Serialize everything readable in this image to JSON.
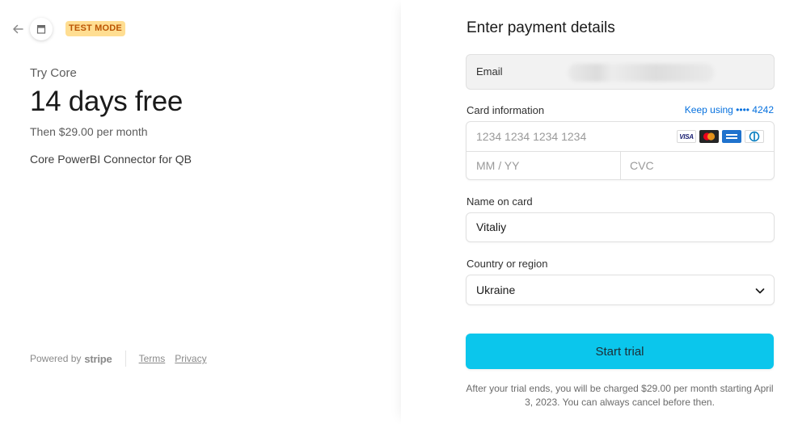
{
  "left": {
    "badge": "TEST MODE",
    "try_label": "Try Core",
    "headline": "14 days free",
    "then_text": "Then $29.00 per month",
    "product": "Core PowerBI Connector for QB",
    "footer": {
      "powered_by": "Powered by",
      "brand": "stripe",
      "terms": "Terms",
      "privacy": "Privacy"
    }
  },
  "right": {
    "heading": "Enter payment details",
    "email": {
      "label": "Email"
    },
    "card": {
      "label": "Card information",
      "keep_using": "Keep using •••• 4242",
      "number_placeholder": "1234 1234 1234 1234",
      "expiry_placeholder": "MM / YY",
      "cvc_placeholder": "CVC",
      "brands": [
        {
          "name": "VISA",
          "icon": "visa-icon"
        },
        {
          "name": "",
          "icon": "mastercard-icon"
        },
        {
          "name": "",
          "icon": "amex-icon"
        },
        {
          "name": "",
          "icon": "diners-icon"
        }
      ]
    },
    "name": {
      "label": "Name on card",
      "value": "Vitaliy"
    },
    "country": {
      "label": "Country or region",
      "value": "Ukraine"
    },
    "submit_label": "Start trial",
    "disclaimer": "After your trial ends, you will be charged $29.00 per month starting April 3, 2023. You can always cancel before then."
  },
  "colors": {
    "accent": "#0bc6ec",
    "link": "#0570de",
    "badge_bg": "#ffde92",
    "badge_text": "#bb5504"
  }
}
